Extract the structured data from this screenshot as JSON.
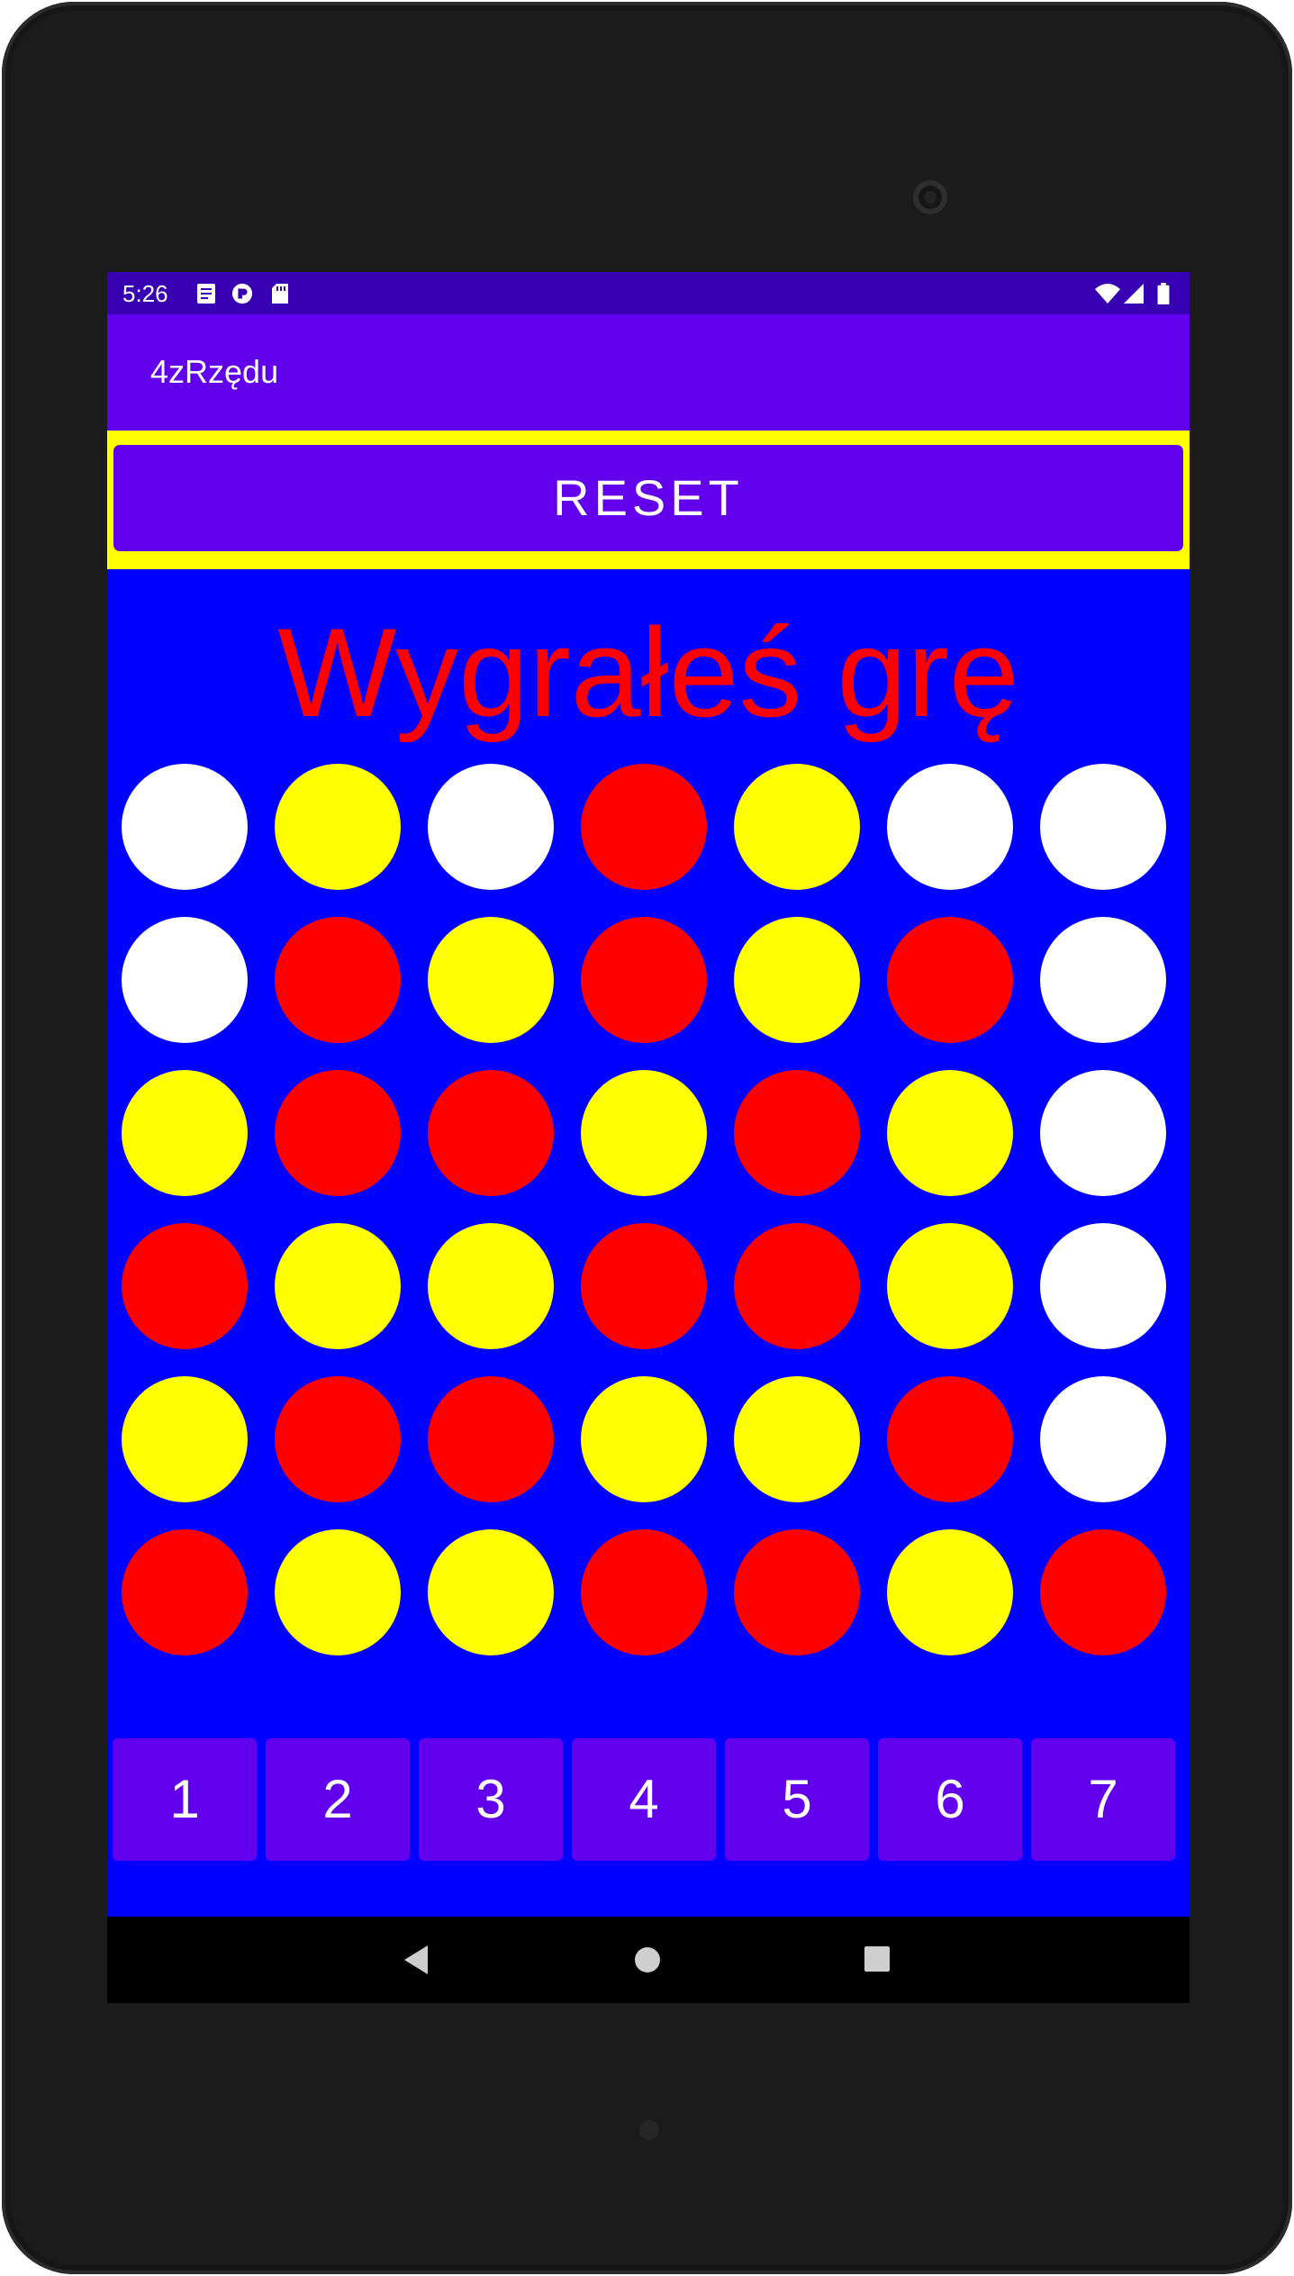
{
  "status_bar": {
    "time": "5:26",
    "left_icons": [
      "notes-icon",
      "pocket-icon",
      "sd-card-icon"
    ],
    "right_icons": [
      "wifi-icon",
      "cellular-signal-icon",
      "battery-icon"
    ]
  },
  "app_bar": {
    "title": "4zRzędu"
  },
  "reset_button": {
    "label": "RESET"
  },
  "message": "Wygrałeś grę",
  "colors": {
    "board_background": "#0000ff",
    "empty": "#ffffff",
    "red": "#ff0000",
    "yellow": "#ffff00",
    "primary": "#6200ee",
    "status_bar": "#3700b3",
    "message": "#ff0000"
  },
  "board": {
    "rows": 6,
    "columns": 7,
    "cells": [
      [
        "empty",
        "yellow",
        "empty",
        "red",
        "yellow",
        "empty",
        "empty"
      ],
      [
        "empty",
        "red",
        "yellow",
        "red",
        "yellow",
        "red",
        "empty"
      ],
      [
        "yellow",
        "red",
        "red",
        "yellow",
        "red",
        "yellow",
        "empty"
      ],
      [
        "red",
        "yellow",
        "yellow",
        "red",
        "red",
        "yellow",
        "empty"
      ],
      [
        "yellow",
        "red",
        "red",
        "yellow",
        "yellow",
        "red",
        "empty"
      ],
      [
        "red",
        "yellow",
        "yellow",
        "red",
        "red",
        "yellow",
        "red"
      ]
    ]
  },
  "column_buttons": [
    "1",
    "2",
    "3",
    "4",
    "5",
    "6",
    "7"
  ],
  "nav_bar": {
    "back": "back-triangle-icon",
    "home": "home-circle-icon",
    "recents": "recents-square-icon"
  }
}
